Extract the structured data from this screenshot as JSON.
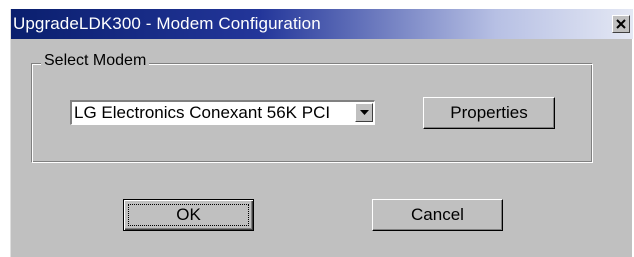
{
  "window": {
    "title": "UpgradeLDK300 - Modem Configuration",
    "close_icon": "close-icon",
    "colors": {
      "titlebar_start": "#0a1f6e",
      "titlebar_end": "#e4e8f4",
      "face": "#c0c0c0"
    }
  },
  "select_modem": {
    "label": "Select Modem",
    "combo_value": "LG Electronics Conexant 56K PCI",
    "dropdown_icon": "chevron-down-icon"
  },
  "buttons": {
    "properties": "Properties",
    "ok": "OK",
    "cancel": "Cancel"
  }
}
